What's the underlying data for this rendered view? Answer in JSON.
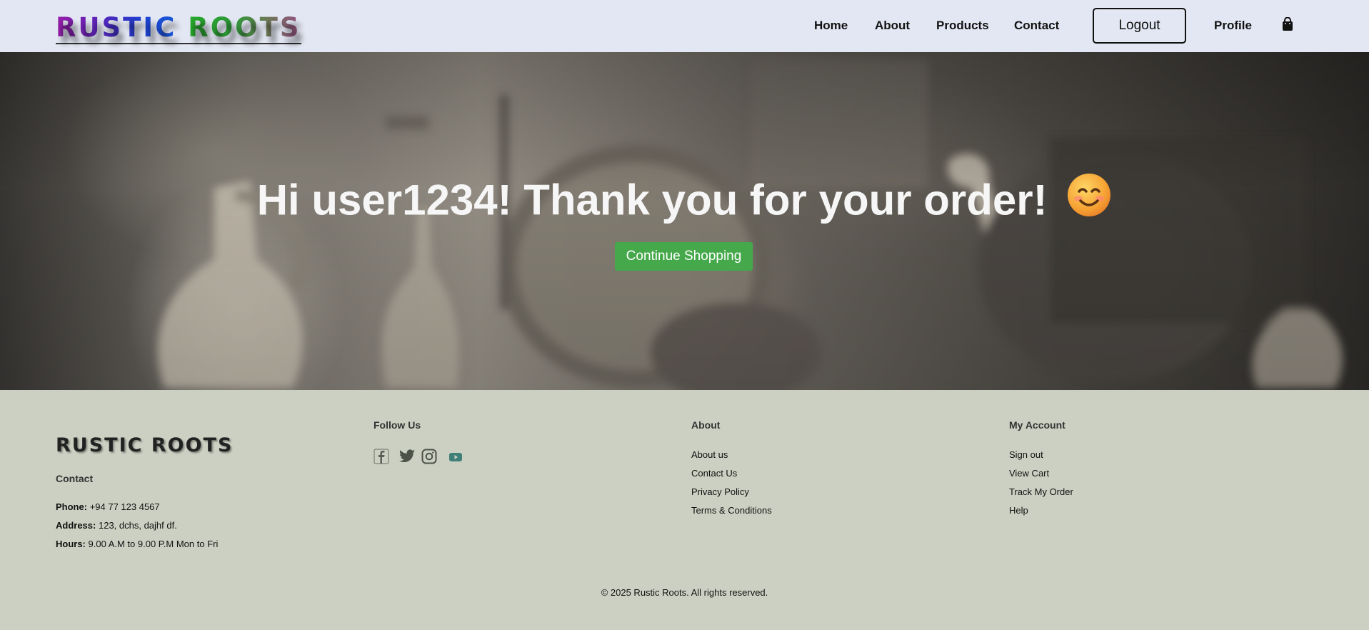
{
  "header": {
    "logo_word1": "RUSTIC",
    "logo_word2": "ROOTS",
    "nav": [
      "Home",
      "About",
      "Products",
      "Contact"
    ],
    "logout_label": "Logout",
    "profile_label": "Profile",
    "cart_icon": "shopping-bag-icon"
  },
  "hero": {
    "title": "Hi user1234! Thank you for your order!",
    "emoji": "😊",
    "button_label": "Continue Shopping",
    "button_color": "#45a84a"
  },
  "footer": {
    "brand": "RUSTIC ROOTS",
    "contact": {
      "heading": "Contact",
      "phone_label": "Phone:",
      "phone": "+94 77 123 4567",
      "address_label": "Address:",
      "address": "123, dchs, dajhf df.",
      "hours_label": "Hours:",
      "hours": "9.00 A.M to 9.00 P.M Mon to Fri"
    },
    "follow": {
      "heading": "Follow Us",
      "icons": [
        "facebook-icon",
        "twitter-icon",
        "instagram-icon",
        "youtube-icon"
      ]
    },
    "about": {
      "heading": "About",
      "links": [
        "About us",
        "Contact Us",
        "Privacy Policy",
        "Terms & Conditions"
      ]
    },
    "account": {
      "heading": "My Account",
      "links": [
        "Sign out",
        "View Cart",
        "Track My Order",
        "Help"
      ]
    },
    "copyright": "© 2025 Rustic Roots. All rights reserved."
  }
}
